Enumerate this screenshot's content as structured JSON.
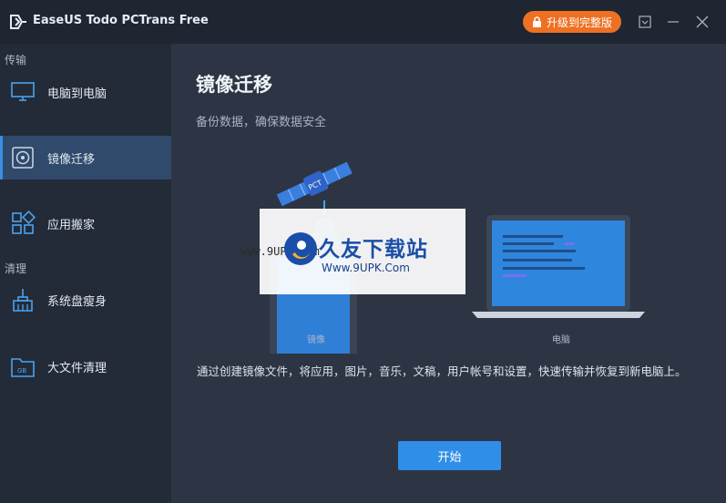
{
  "app": {
    "title": "EaseUS Todo PCTrans Free",
    "upgrade_label": "升级到完整版"
  },
  "sidebar": {
    "sections": [
      {
        "label": "传输"
      },
      {
        "label": "清理"
      }
    ],
    "items": [
      {
        "label": "电脑到电脑",
        "icon": "monitor-icon"
      },
      {
        "label": "镜像迁移",
        "icon": "disc-icon",
        "active": true
      },
      {
        "label": "应用搬家",
        "icon": "apps-icon"
      },
      {
        "label": "系统盘瘦身",
        "icon": "broom-icon"
      },
      {
        "label": "大文件清理",
        "icon": "gb-folder-icon"
      }
    ]
  },
  "main": {
    "title": "镜像迁移",
    "subtitle": "备份数据，确保数据安全",
    "illustration": {
      "left_caption": "镜像",
      "right_caption": "电脑",
      "satellite_text": "PCT"
    },
    "description": "通过创建镜像文件，将应用，图片，音乐，文稿，用户帐号和设置，快速传输并恢复到新电脑上。",
    "start_label": "开始"
  },
  "watermark": {
    "url_left": "www.9UPK.com",
    "brand": "久友下载站",
    "url": "Www.9UPK.Com"
  },
  "colors": {
    "accent": "#2f8ee8",
    "upgrade": "#ee7023",
    "sidebar_active": "#2f4a6b"
  }
}
